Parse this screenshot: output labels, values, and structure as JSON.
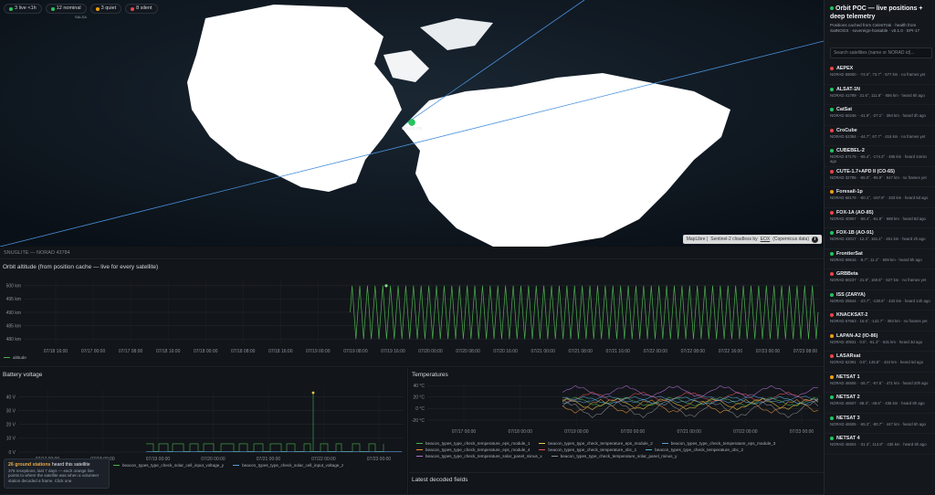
{
  "map": {
    "chips": [
      {
        "label": "3 live <1h",
        "color": "#22c55e"
      },
      {
        "label": "12 nominal",
        "color": "#22c55e"
      },
      {
        "label": "3 quiet",
        "color": "#f59e0b"
      },
      {
        "label": "8 silent",
        "color": "#ef4444"
      }
    ],
    "mini_label": "SALSA",
    "satellite_label": "SNUGLITE",
    "attribution_prefix": "MapLibre | ",
    "attribution_body": "Sentinel-2 cloudless by ",
    "attribution_link": "EOX",
    "attribution_suffix": " (Copernicus data)",
    "info": "i"
  },
  "telemetry": {
    "header": "SNUGLITE — NORAD 43784"
  },
  "altitude": {
    "title": "Orbit altitude (from position cache — live for every satellite)",
    "legend": "altitude",
    "legend_color": "#4caf50"
  },
  "battery": {
    "title": "Battery voltage",
    "legend": [
      {
        "label": "beacon_types_type_check_solar_cell_input_voltage_y",
        "color": "#4caf50"
      },
      {
        "label": "beacon_types_type_check_solar_cell_input_voltage_z",
        "color": "#5b9bd5"
      }
    ]
  },
  "temperatures": {
    "title": "Temperatures",
    "legend": [
      {
        "label": "beacon_types_type_check_temperature_eps_module_1",
        "color": "#4caf50"
      },
      {
        "label": "beacon_types_type_check_temperature_eps_module_2",
        "color": "#e8c547"
      },
      {
        "label": "beacon_types_type_check_temperature_eps_module_3",
        "color": "#5b9bd5"
      },
      {
        "label": "beacon_types_type_check_temperature_eps_module_4",
        "color": "#e8913a"
      },
      {
        "label": "beacon_types_type_check_temperature_obc_1",
        "color": "#e05252"
      },
      {
        "label": "beacon_types_type_check_temperature_obc_2",
        "color": "#4fb3d9"
      },
      {
        "label": "beacon_types_type_check_temperature_solar_panel_minus_x",
        "color": "#b16fd6"
      },
      {
        "label": "beacon_types_type_check_temperature_solar_panel_minus_y",
        "color": "#8a8f96"
      }
    ]
  },
  "decoded": {
    "title": "Latest decoded fields"
  },
  "ground": {
    "count_text": "26 ground stations",
    "rest": " heard this satellite",
    "detail": "375 receptions, last 7 days — each orange line points to where the satellite was when a volunteer station decoded a frame. Click one."
  },
  "sidebar": {
    "title": "Orbit POC — live positions + deep telemetry",
    "subtitle": "Positions cached from CelesTrak · health from SatNOGS · sovereign-hostable · v0.1.0 · EPI-17",
    "search_placeholder": "Search satellites (name or NORAD id)...",
    "satellites": [
      {
        "name": "AEPEX",
        "meta": "NORAD 59000 · -74.0°, 73.7° · 577 km · no frames yet",
        "status": "#ef4444"
      },
      {
        "name": "ALSAT-1N",
        "meta": "NORAD 41789 · 21.6°, 111.8° · 656 km · heard 6h ago",
        "status": "#22c55e"
      },
      {
        "name": "CatSat",
        "meta": "NORAD 60246 · -41.9°, -27.1° · 394 km · heard 3h ago",
        "status": "#22c55e"
      },
      {
        "name": "CroCube",
        "meta": "NORAD 62394 · -44.7°, 67.7° · 416 km · no frames yet",
        "status": "#ef4444"
      },
      {
        "name": "CUBEBEL-2",
        "meta": "NORAD 57175 · -65.4°, -174.3° · 486 km · heard 44min ago",
        "status": "#22c55e"
      },
      {
        "name": "CUTE-1.7+APD II (CO-65)",
        "meta": "NORAD 32785 · -55.0°, -95.9° · 547 km · no frames yet",
        "status": "#ef4444"
      },
      {
        "name": "Foresail-1p",
        "meta": "NORAD 68178 · -60.1°, -167.9° · 333 km · heard 5d ago",
        "status": "#f59e0b"
      },
      {
        "name": "FOX-1A (AO-85)",
        "meta": "NORAD 40967 · -58.4°, -61.8° · 688 km · heard 8d ago",
        "status": "#ef4444"
      },
      {
        "name": "FOX-1B (AO-91)",
        "meta": "NORAD 43017 · 12.3°, 161.4° · 451 km · heard 2h ago",
        "status": "#22c55e"
      },
      {
        "name": "FrontierSat",
        "meta": "NORAD 69616 · -8.7°, 11.4° · 609 km · heard 6h ago",
        "status": "#22c55e"
      },
      {
        "name": "GRBBeta",
        "meta": "NORAD 60237 · 21.9°, 160.8° · 527 km · no frames yet",
        "status": "#ef4444"
      },
      {
        "name": "ISS (ZARYA)",
        "meta": "NORAD 25544 · -23.7°, -130.6° · 432 km · heard 14h ago",
        "status": "#22c55e"
      },
      {
        "name": "KNACKSAT-2",
        "meta": "NORAD 67663 · 16.6°, -142.7° · 393 km · no frames yet",
        "status": "#ef4444"
      },
      {
        "name": "LAPAN-A2 (IO-86)",
        "meta": "NORAD 40931 · 0.0°, -61.3° · 631 km · heard 3d ago",
        "status": "#f59e0b"
      },
      {
        "name": "LASARsat",
        "meta": "NORAD 62391 · 0.0°, 146.8° · 434 km · heard 5d ago",
        "status": "#ef4444"
      },
      {
        "name": "NETSAT 1",
        "meta": "NORAD 46506 · -26.7°, -57.6° · 471 km · heard 20h ago",
        "status": "#f59e0b"
      },
      {
        "name": "NETSAT 2",
        "meta": "NORAD 46507 · 68.3°, -49.6° · 436 km · heard 8h ago",
        "status": "#22c55e"
      },
      {
        "name": "NETSAT 3",
        "meta": "NORAD 46505 · -65.3°, -80.7° · 447 km · heard 6h ago",
        "status": "#22c55e"
      },
      {
        "name": "NETSAT 4",
        "meta": "NORAD 46504 · -31.3°, 114.8° · 436 km · heard 6h ago",
        "status": "#22c55e"
      }
    ]
  },
  "chart_data": [
    {
      "type": "line",
      "title": "Orbit altitude (from position cache — live for every satellite)",
      "ylabel_unit": "km",
      "yticks": [
        "500 km",
        "495 km",
        "490 km",
        "485 km",
        "480 km"
      ],
      "ylim": [
        478,
        502
      ],
      "xticks": [
        "07/18 16:00",
        "07/17 00:00",
        "07/17 08:00",
        "07/18 16:00",
        "07/18 00:00",
        "07/18 08:00",
        "07/18 16:00",
        "07/19 00:00",
        "07/19 08:00",
        "07/19 16:00",
        "07/20 00:00",
        "07/20 08:00",
        "07/20 16:00",
        "07/21 00:00",
        "07/21 08:00",
        "07/21 16:00",
        "07/22 00:00",
        "07/22 08:00",
        "07/22 16:00",
        "07/23 00:00",
        "07/23 08:00"
      ],
      "series": [
        {
          "name": "altitude",
          "start_fraction": 0.41,
          "cycles": 61,
          "min": 480,
          "max": 500
        }
      ]
    },
    {
      "type": "line",
      "title": "Battery voltage",
      "yticks": [
        "40 V",
        "30 V",
        "20 V",
        "10 V",
        "0 V"
      ],
      "ylim": [
        0,
        45
      ],
      "xticks": [
        "07/17 00:00",
        "07/18 00:00",
        "07/19 00:00",
        "07/20 00:00",
        "07/21 00:00",
        "07/22 00:00",
        "07/23 00:00"
      ],
      "spike_value": 43
    },
    {
      "type": "line",
      "title": "Temperatures",
      "yticks": [
        "40 °C",
        "20 °C",
        "0 °C",
        "-20 °C"
      ],
      "ylim": [
        -28,
        45
      ],
      "xticks": [
        "07/17 00:00",
        "07/18 00:00",
        "07/19 00:00",
        "07/20 00:00",
        "07/21 00:00",
        "07/22 00:00",
        "07/23 00:00"
      ]
    }
  ]
}
